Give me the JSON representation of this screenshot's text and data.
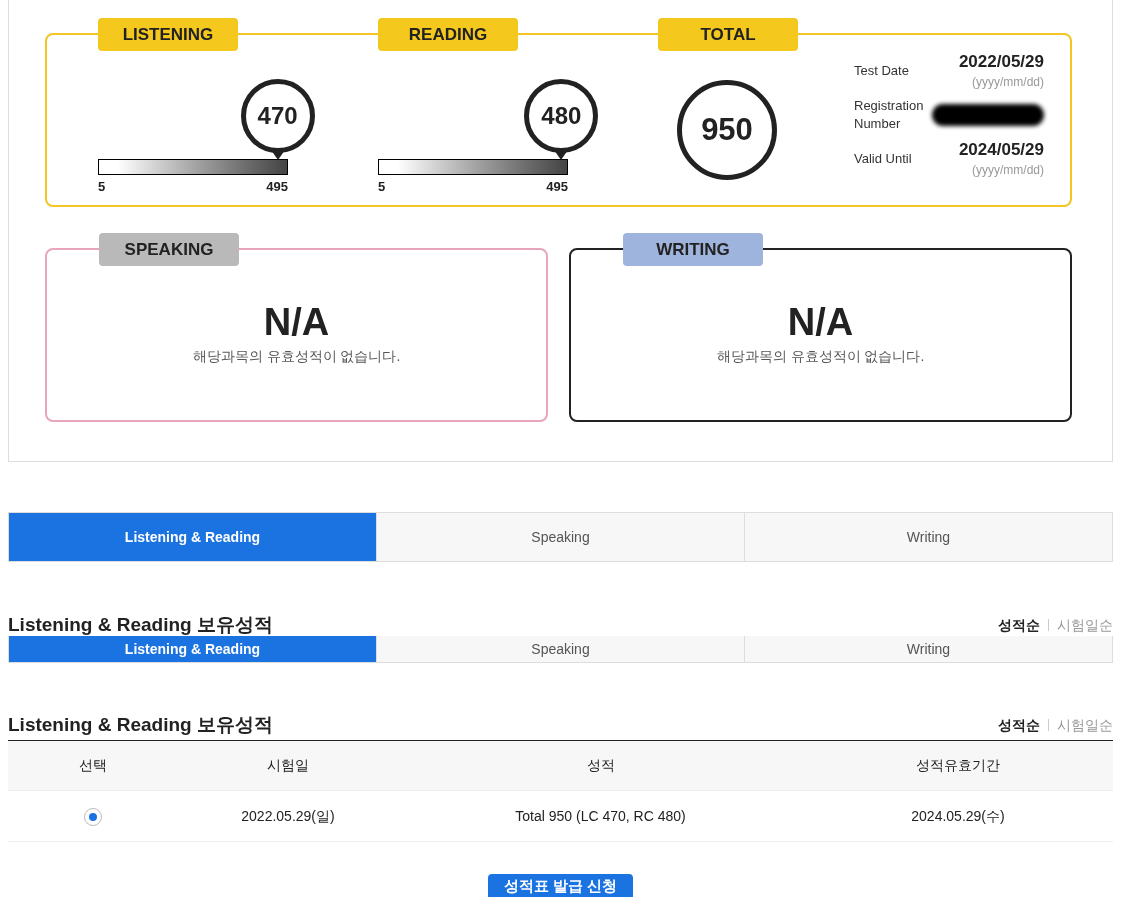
{
  "score_card": {
    "sections": [
      {
        "label": "LISTENING",
        "score": "470",
        "level": 0.95,
        "min": "5",
        "max": "495"
      },
      {
        "label": "READING",
        "score": "480",
        "level": 0.97,
        "min": "5",
        "max": "495"
      }
    ],
    "total": {
      "label": "TOTAL",
      "score": "950"
    },
    "info": [
      {
        "kind": "date",
        "label": "Test Date",
        "value": "2022/05/29",
        "hint": "(yyyy/mm/dd)"
      },
      {
        "kind": "redacted",
        "label": "Registration Number"
      },
      {
        "kind": "date",
        "label": "Valid Until",
        "value": "2024/05/29",
        "hint": "(yyyy/mm/dd)"
      }
    ]
  },
  "other_scores": [
    {
      "kind": "speaking",
      "label": "SPEAKING",
      "score": "N/A",
      "message": "해당과목의 유효성적이 없습니다."
    },
    {
      "kind": "writing",
      "label": "WRITING",
      "score": "N/A",
      "message": "해당과목의 유효성적이 없습니다."
    }
  ],
  "tabs": [
    {
      "label": "Listening & Reading",
      "selected": true
    },
    {
      "label": "Speaking",
      "selected": false
    },
    {
      "label": "Writing",
      "selected": false
    }
  ],
  "heading": "Listening & Reading 보유성적",
  "sort_options": [
    {
      "label": "성적순",
      "selected": true
    },
    {
      "label": "시험일순",
      "selected": false
    }
  ],
  "tabs_repeat": [
    {
      "label": "Listening & Reading",
      "selected": true
    },
    {
      "label": "Speaking",
      "selected": false
    },
    {
      "label": "Writing",
      "selected": false
    }
  ],
  "heading_repeat": "Listening & Reading 보유성적",
  "sort_options_repeat": [
    {
      "label": "성적순",
      "selected": true
    },
    {
      "label": "시험일순",
      "selected": false
    }
  ],
  "table": {
    "columns": [
      "선택",
      "시험일",
      "성적",
      "성적유효기간"
    ],
    "rows": [
      {
        "selected": true,
        "test_date": "2022.05.29(일)",
        "score": "Total 950 (LC 470, RC 480)",
        "valid_until": "2024.05.29(수)"
      }
    ]
  },
  "button": "성적표 발급 신청"
}
